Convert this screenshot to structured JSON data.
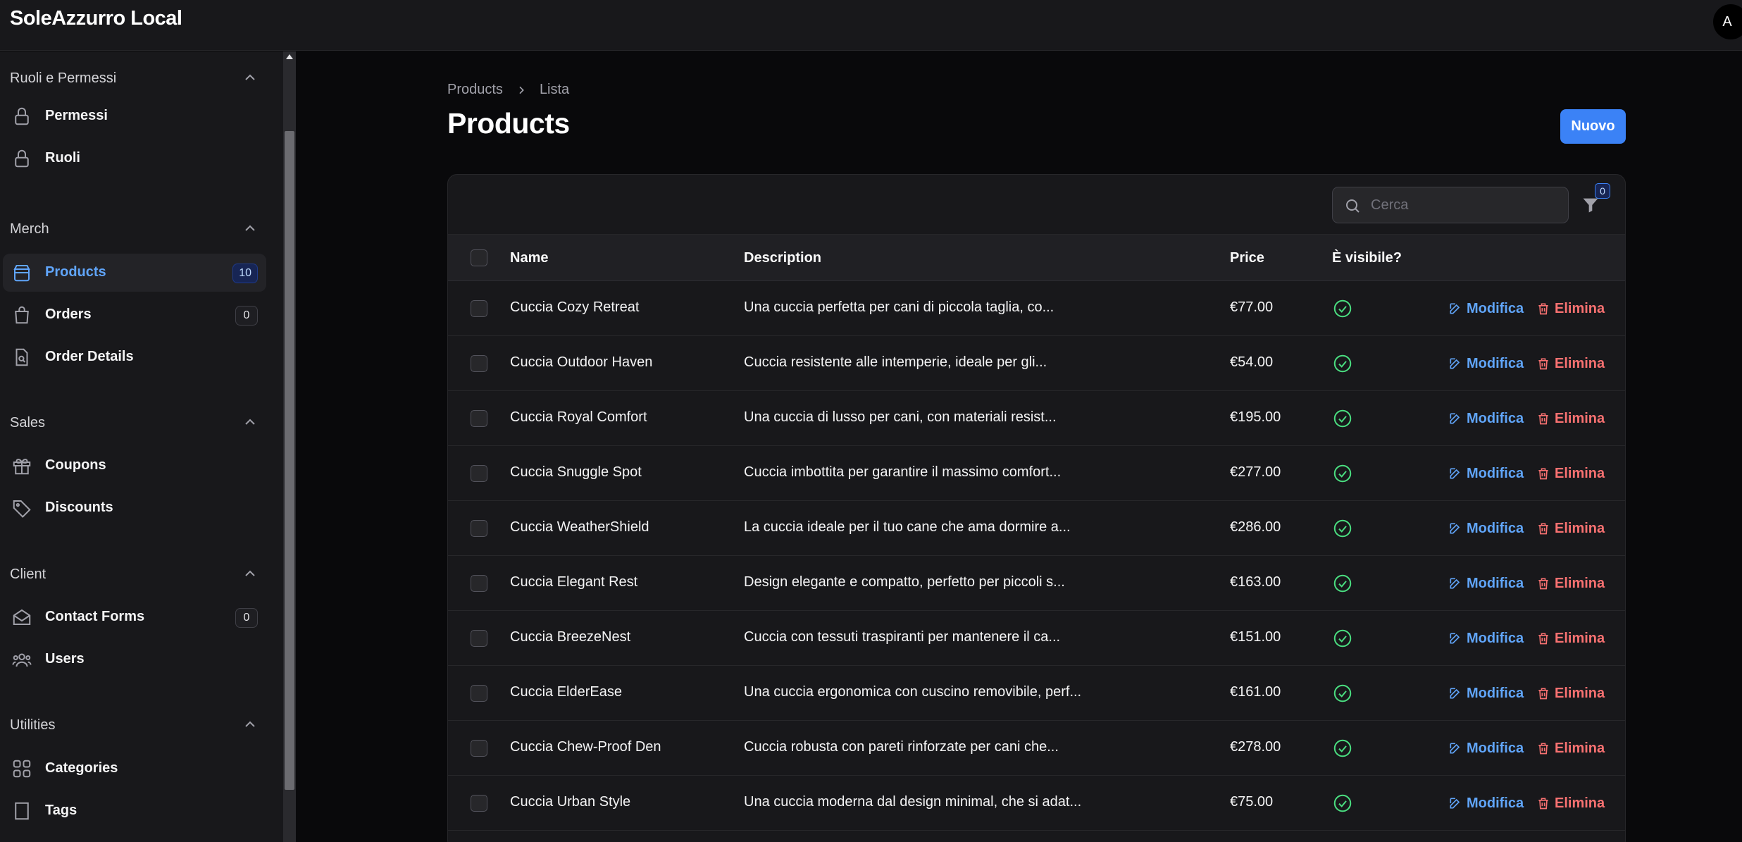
{
  "app": {
    "title": "SoleAzzurro Local",
    "avatar_initial": "A"
  },
  "sidebar": {
    "groups": [
      {
        "title": "Ruoli e Permessi",
        "items": [
          {
            "label": "Permessi",
            "icon": "lock-icon",
            "badge": null
          },
          {
            "label": "Ruoli",
            "icon": "lock-icon",
            "badge": null
          }
        ]
      },
      {
        "title": "Merch",
        "items": [
          {
            "label": "Products",
            "icon": "archive-box-icon",
            "badge": "10",
            "active": true
          },
          {
            "label": "Orders",
            "icon": "shopping-bag-icon",
            "badge": "0"
          },
          {
            "label": "Order Details",
            "icon": "document-search-icon",
            "badge": null
          }
        ]
      },
      {
        "title": "Sales",
        "items": [
          {
            "label": "Coupons",
            "icon": "gift-icon",
            "badge": null
          },
          {
            "label": "Discounts",
            "icon": "tag-icon",
            "badge": null
          }
        ]
      },
      {
        "title": "Client",
        "items": [
          {
            "label": "Contact Forms",
            "icon": "envelope-open-icon",
            "badge": "0"
          },
          {
            "label": "Users",
            "icon": "user-group-icon",
            "badge": null
          }
        ]
      },
      {
        "title": "Utilities",
        "items": [
          {
            "label": "Categories",
            "icon": "squares-icon",
            "badge": null
          },
          {
            "label": "Tags",
            "icon": "bookmark-icon",
            "badge": null
          }
        ]
      }
    ]
  },
  "breadcrumb": {
    "items": [
      "Products",
      "Lista"
    ]
  },
  "page": {
    "title": "Products",
    "new_button": "Nuovo"
  },
  "table": {
    "search_placeholder": "Cerca",
    "filter_count": "0",
    "columns": {
      "name": "Name",
      "description": "Description",
      "price": "Price",
      "visible": "È visibile?"
    },
    "edit_label": "Modifica",
    "delete_label": "Elimina",
    "rows": [
      {
        "name": "Cuccia Cozy Retreat",
        "description": "Una cuccia perfetta per cani di piccola taglia, co...",
        "price": "€77.00",
        "visible": true
      },
      {
        "name": "Cuccia Outdoor Haven",
        "description": "Cuccia resistente alle intemperie, ideale per gli...",
        "price": "€54.00",
        "visible": true
      },
      {
        "name": "Cuccia Royal Comfort",
        "description": "Una cuccia di lusso per cani, con materiali resist...",
        "price": "€195.00",
        "visible": true
      },
      {
        "name": "Cuccia Snuggle Spot",
        "description": "Cuccia imbottita per garantire il massimo comfort...",
        "price": "€277.00",
        "visible": true
      },
      {
        "name": "Cuccia WeatherShield",
        "description": "La cuccia ideale per il tuo cane che ama dormire a...",
        "price": "€286.00",
        "visible": true
      },
      {
        "name": "Cuccia Elegant Rest",
        "description": "Design elegante e compatto, perfetto per piccoli s...",
        "price": "€163.00",
        "visible": true
      },
      {
        "name": "Cuccia BreezeNest",
        "description": "Cuccia con tessuti traspiranti per mantenere il ca...",
        "price": "€151.00",
        "visible": true
      },
      {
        "name": "Cuccia ElderEase",
        "description": "Una cuccia ergonomica con cuscino removibile, perf...",
        "price": "€161.00",
        "visible": true
      },
      {
        "name": "Cuccia Chew-Proof Den",
        "description": "Cuccia robusta con pareti rinforzate per cani che...",
        "price": "€278.00",
        "visible": true
      },
      {
        "name": "Cuccia Urban Style",
        "description": "Una cuccia moderna dal design minimal, che si adat...",
        "price": "€75.00",
        "visible": true
      }
    ]
  },
  "colors": {
    "accent": "#3b82f6",
    "edit": "#60a5fa",
    "delete": "#f87171",
    "success": "#4ade80"
  }
}
